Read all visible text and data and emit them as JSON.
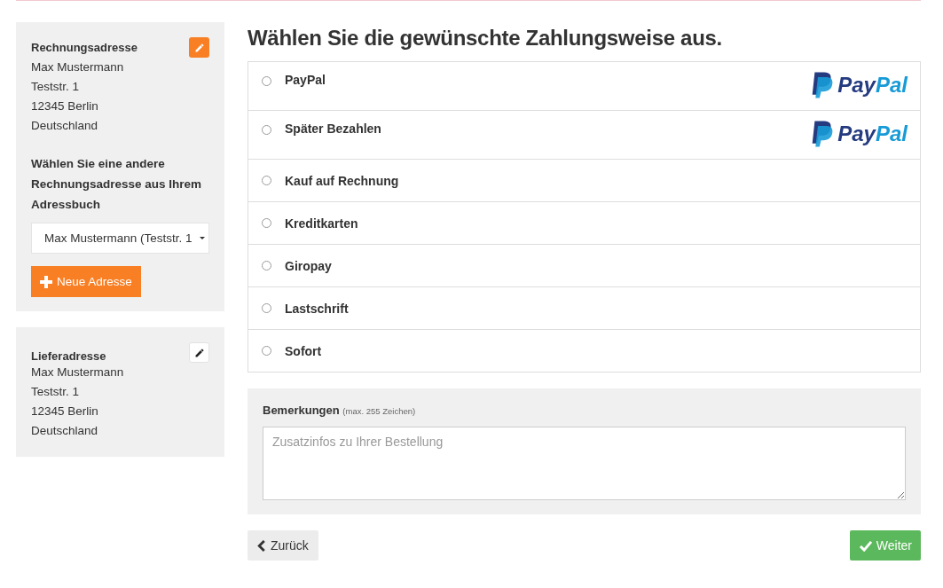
{
  "billing": {
    "title": "Rechnungsadresse",
    "address": [
      "Max Mustermann",
      "Teststr. 1",
      "12345 Berlin",
      "Deutschland"
    ],
    "choose_label": "Wählen Sie eine andere Rechnungsadresse aus Ihrem Adressbuch",
    "select_value": "Max Mustermann (Teststr. 1",
    "new_button": "Neue Adresse"
  },
  "shipping": {
    "title": "Lieferadresse",
    "address": [
      "Max Mustermann",
      "Teststr. 1",
      "12345 Berlin",
      "Deutschland"
    ]
  },
  "heading": "Wählen Sie die gewünschte Zahlungsweise aus.",
  "payment_methods": [
    {
      "label": "PayPal",
      "selected": false,
      "logo": {
        "part1": "Pay",
        "part2": "Pal"
      }
    },
    {
      "label": "Später Bezahlen",
      "selected": false,
      "logo": {
        "part1": "Pay",
        "part2": "Pal"
      }
    },
    {
      "label": "Kauf auf Rechnung",
      "selected": false
    },
    {
      "label": "Kreditkarten",
      "selected": false
    },
    {
      "label": "Giropay",
      "selected": false
    },
    {
      "label": "Lastschrift",
      "selected": false
    },
    {
      "label": "Sofort",
      "selected": false
    }
  ],
  "remarks": {
    "label": "Bemerkungen",
    "hint": "(max. 255 Zeichen)",
    "placeholder": "Zusatzinfos zu Ihrer Bestellung"
  },
  "back_button": "Zurück",
  "next_button": "Weiter"
}
